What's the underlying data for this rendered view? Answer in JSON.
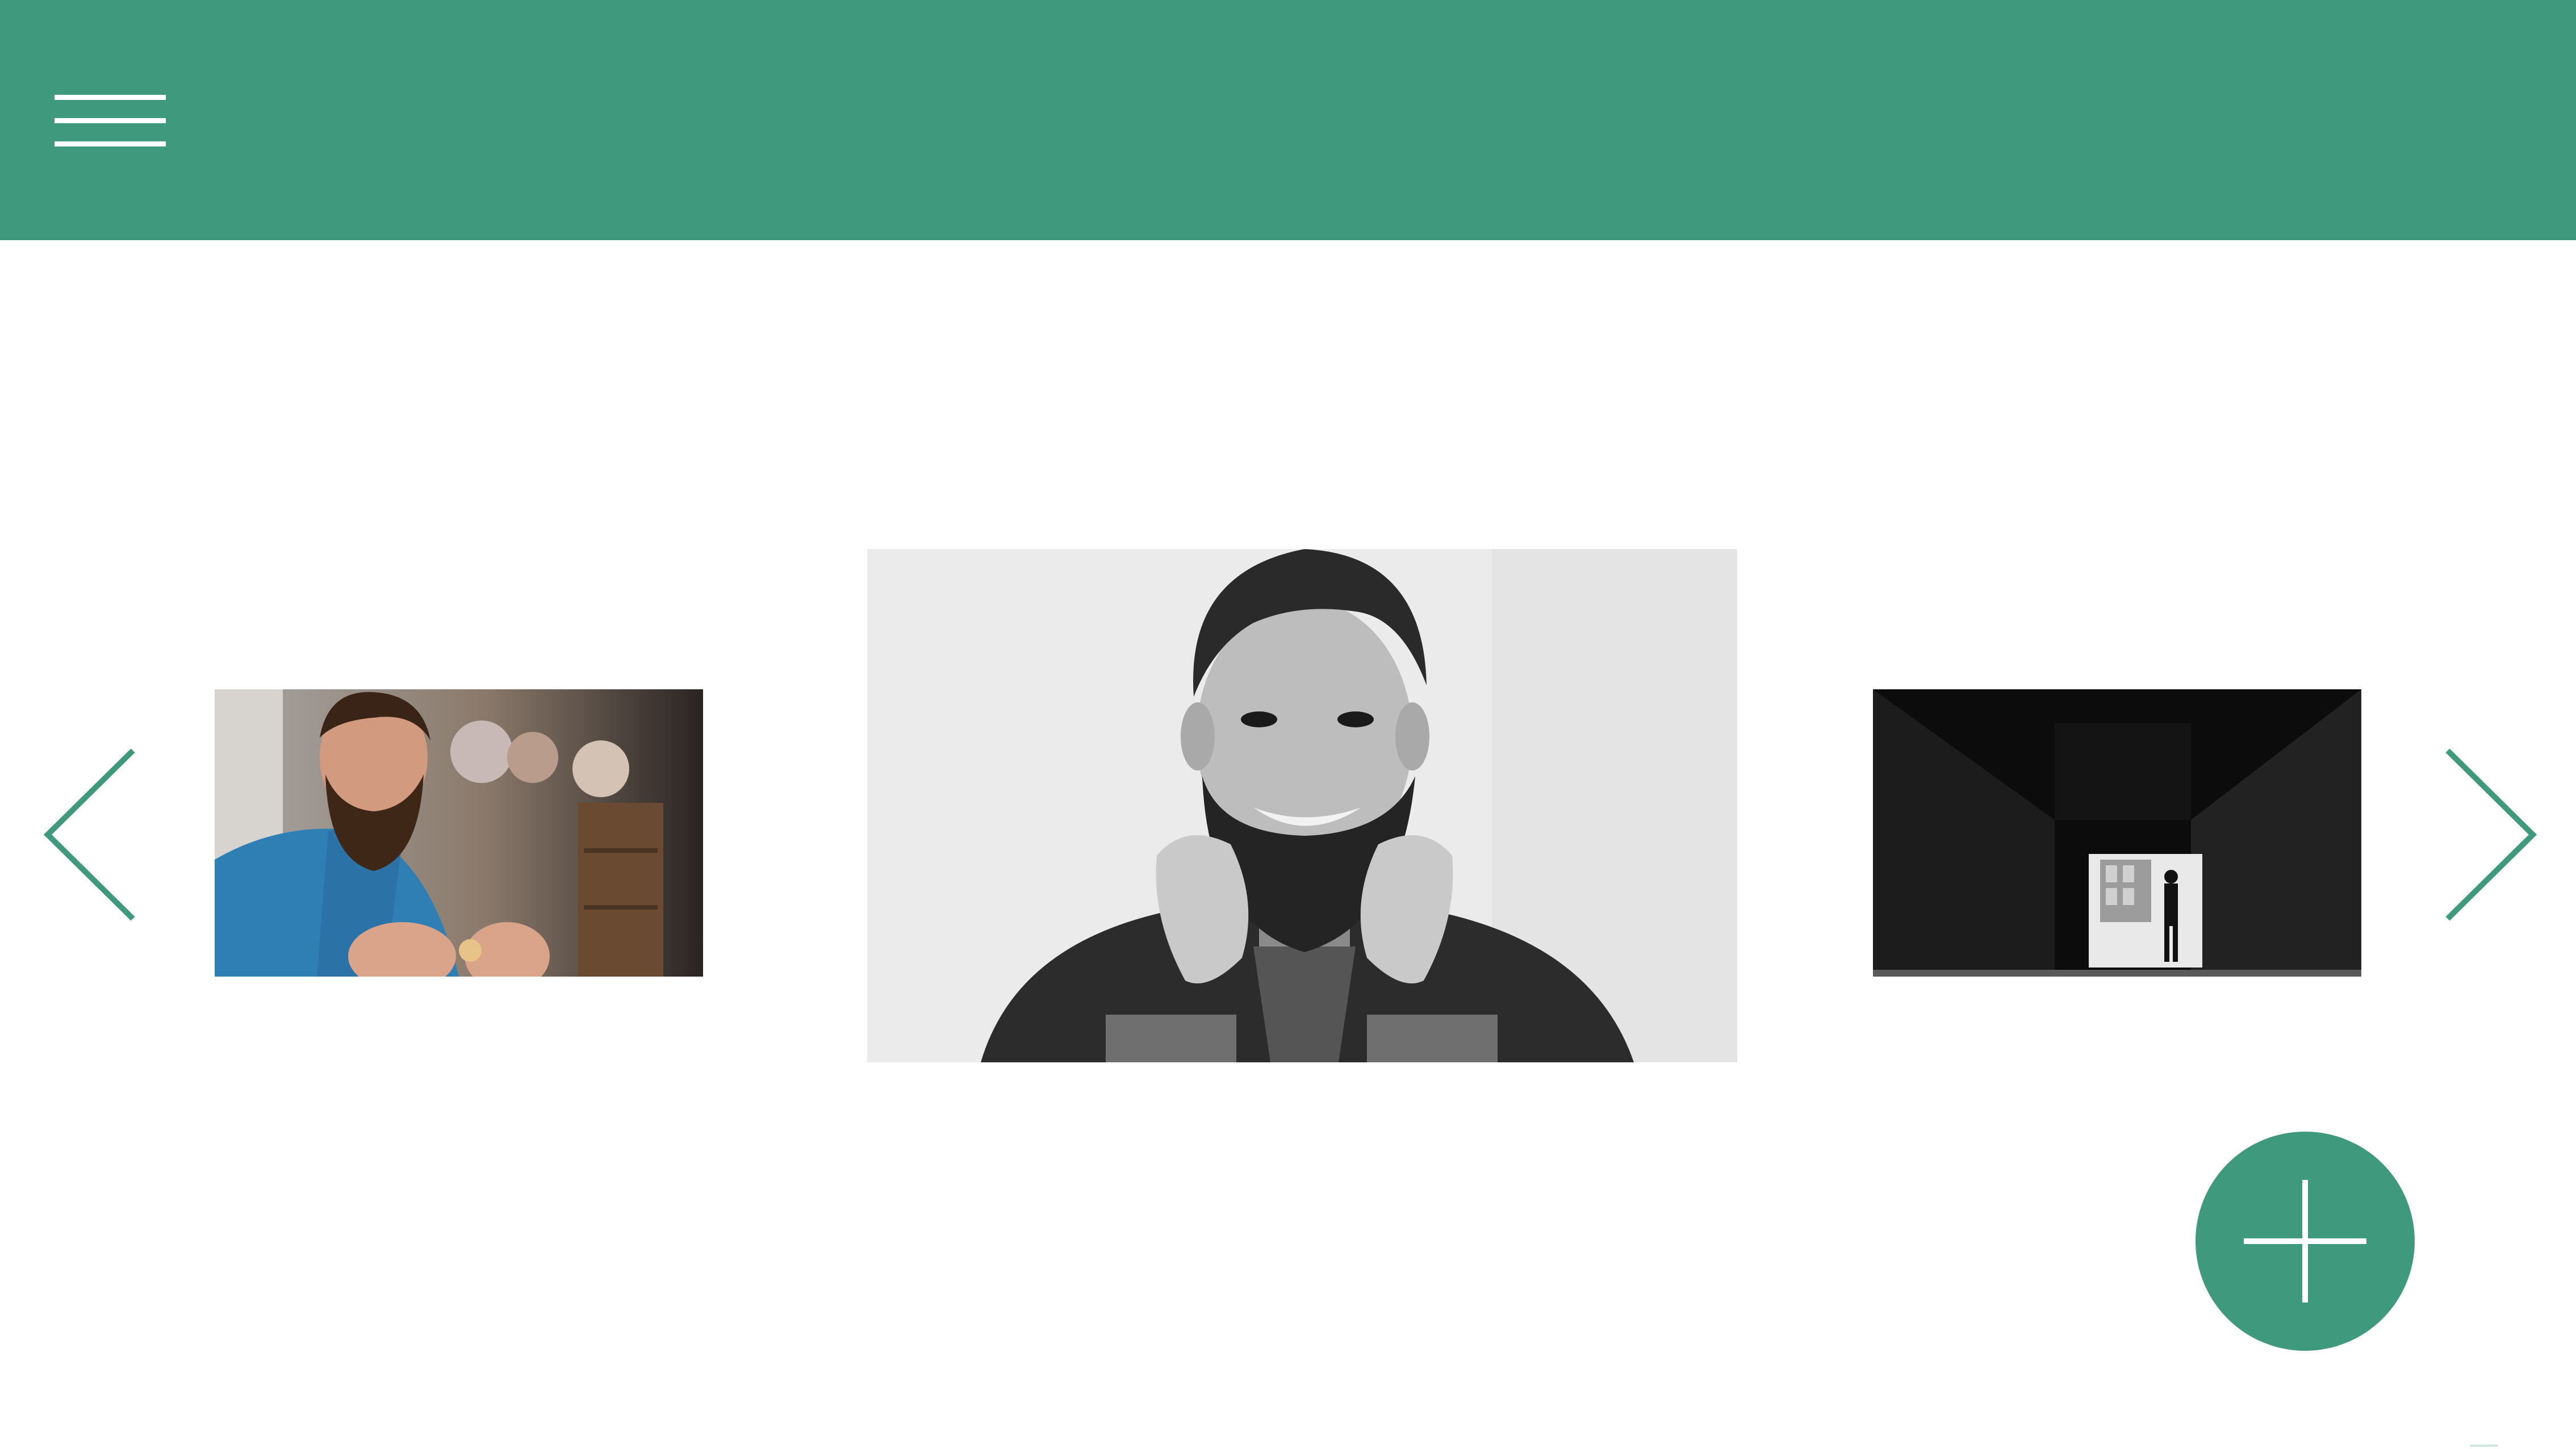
{
  "theme": {
    "accent": "#3f997c",
    "background": "#ffffff"
  },
  "header": {
    "menu_icon": "hamburger-menu-icon"
  },
  "carousel": {
    "prev_icon": "chevron-left-icon",
    "next_icon": "chevron-right-icon",
    "photos": [
      {
        "name": "photo-bearded-man-blue-shirt",
        "position": "left",
        "tone": "color"
      },
      {
        "name": "photo-smiling-bearded-man-portrait",
        "position": "center",
        "tone": "black-and-white",
        "selected": true
      },
      {
        "name": "photo-dark-corridor-silhouette",
        "position": "right",
        "tone": "black-and-white"
      }
    ]
  },
  "fab": {
    "icon": "plus-icon"
  }
}
